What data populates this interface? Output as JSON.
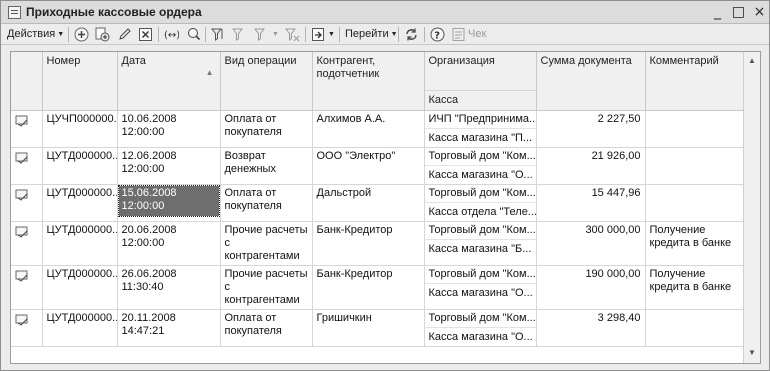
{
  "window": {
    "title": "Приходные кассовые ордера",
    "controls": [
      "_",
      "□",
      "×"
    ]
  },
  "toolbar": {
    "actions_label": "Действия",
    "goto_label": "Перейти",
    "check_label": "Чек",
    "icons": [
      "add-icon",
      "copy-icon",
      "edit-icon",
      "delete-icon",
      "refresh-icon",
      "search-icon",
      "filter-icon",
      "filter-list-icon",
      "filter-clear-icon",
      "post-icon",
      "sync-icon",
      "help-icon",
      "receipt-icon"
    ]
  },
  "table": {
    "columns": {
      "number": "Номер",
      "date": "Дата",
      "operation": "Вид операции",
      "counterparty": "Контрагент, подотчетник",
      "organization": "Организация",
      "cashbox": "Касса",
      "amount": "Сумма документа",
      "comment": "Комментарий"
    },
    "rows": [
      {
        "number": "ЦУЧП000000...",
        "date": "10.06.2008",
        "time": "12:00:00",
        "operation": "Оплата от покупателя",
        "counterparty": "Алхимов А.А.",
        "organization": "ИЧП \"Предпринима...",
        "cashbox": "Касса магазина \"П...",
        "amount": "2 227,50",
        "comment": ""
      },
      {
        "number": "ЦУТД000000...",
        "date": "12.06.2008",
        "time": "12:00:00",
        "operation": "Возврат денежных",
        "counterparty": "ООО \"Электро\"",
        "organization": "Торговый дом \"Ком...",
        "cashbox": "Касса магазина \"О...",
        "amount": "21 926,00",
        "comment": ""
      },
      {
        "number": "ЦУТД000000...",
        "date": "15.06.2008",
        "time": "12:00:00",
        "operation": "Оплата от покупателя",
        "counterparty": "Дальстрой",
        "organization": "Торговый дом \"Ком...",
        "cashbox": "Касса отдела \"Теле...",
        "amount": "15 447,96",
        "comment": ""
      },
      {
        "number": "ЦУТД000000...",
        "date": "20.06.2008",
        "time": "12:00:00",
        "operation": "Прочие расчеты с контрагентами",
        "counterparty": "Банк-Кредитор",
        "organization": "Торговый дом \"Ком...",
        "cashbox": "Касса магазина \"Б...",
        "amount": "300 000,00",
        "comment": "Получение кредита в банке"
      },
      {
        "number": "ЦУТД000000...",
        "date": "26.06.2008",
        "time": "11:30:40",
        "operation": "Прочие расчеты с контрагентами",
        "counterparty": "Банк-Кредитор",
        "organization": "Торговый дом \"Ком...",
        "cashbox": "Касса магазина \"О...",
        "amount": "190 000,00",
        "comment": "Получение кредита в банке"
      },
      {
        "number": "ЦУТД000000...",
        "date": "20.11.2008",
        "time": "14:47:21",
        "operation": "Оплата от покупателя",
        "counterparty": "Гришичкин",
        "organization": "Торговый дом \"Ком...",
        "cashbox": "Касса магазина \"О...",
        "amount": "3 298,40",
        "comment": ""
      }
    ]
  },
  "colors": {
    "selected_cell": "#6e6e6e",
    "header_bg": "#f0f0f0",
    "window_bg": "#ececec"
  }
}
